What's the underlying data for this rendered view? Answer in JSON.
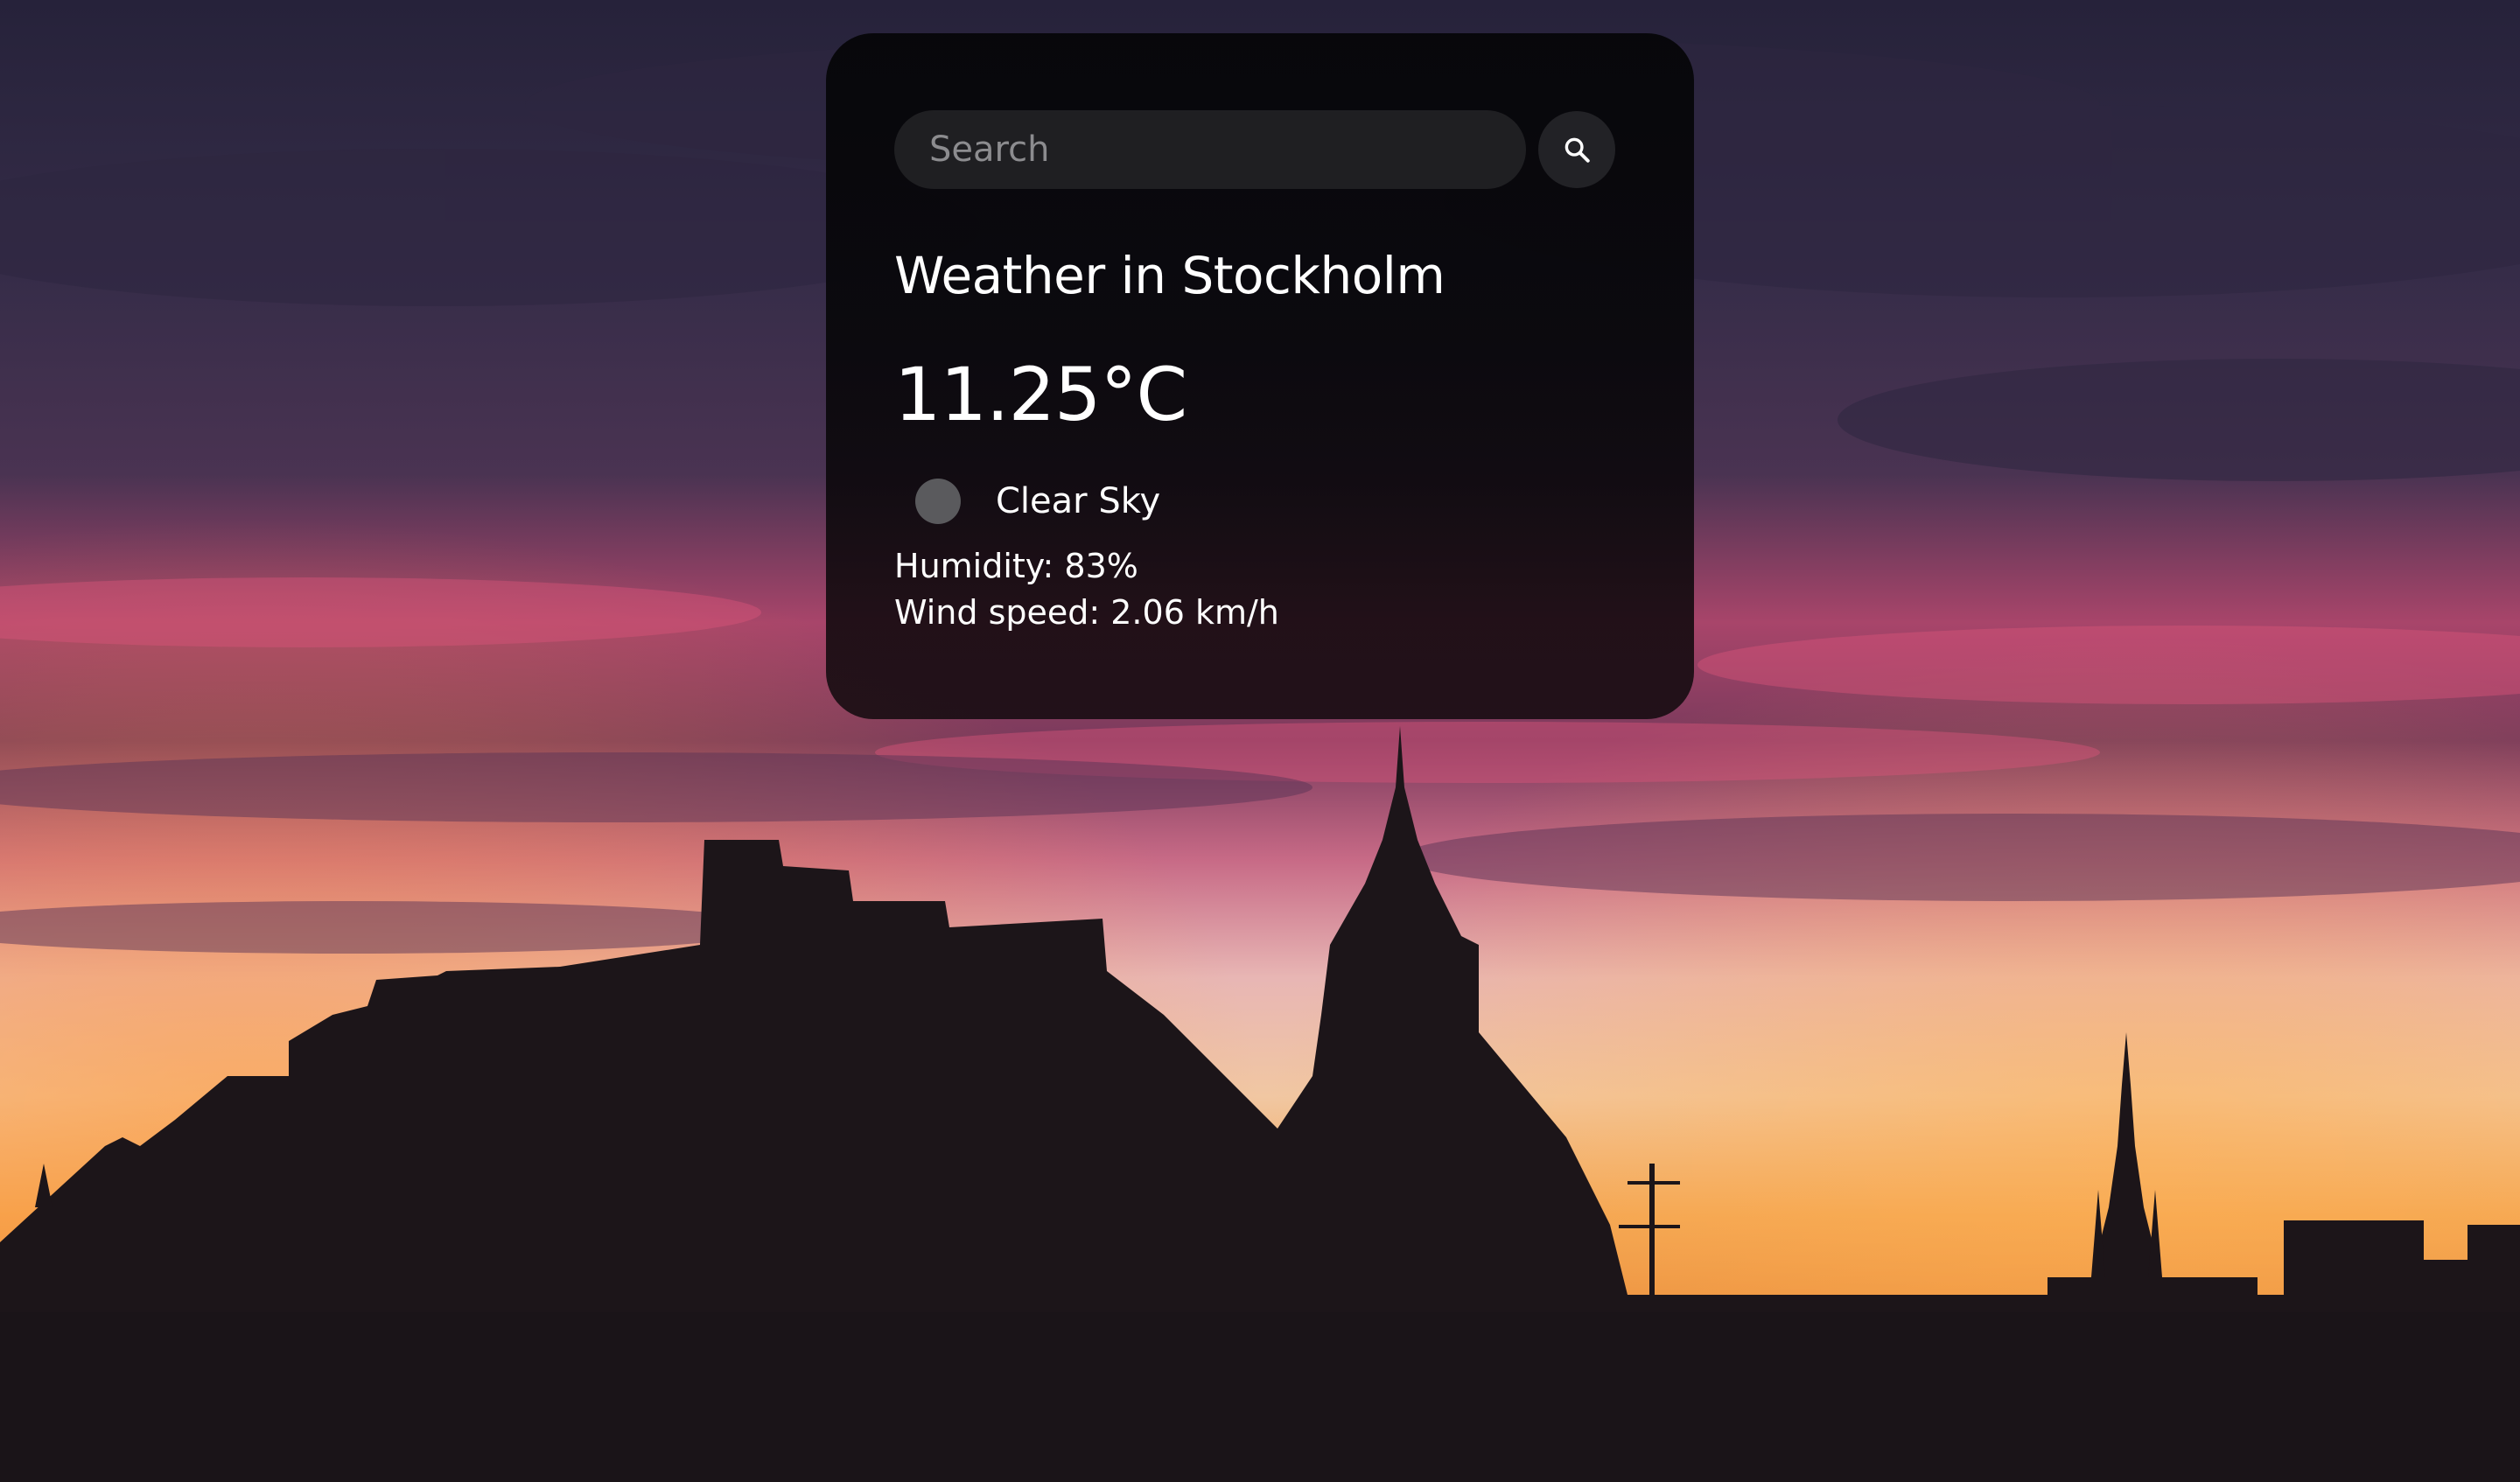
{
  "search": {
    "placeholder": "Search",
    "value": "",
    "button_icon": "search-icon"
  },
  "weather": {
    "city_title": "Weather in Stockholm",
    "temperature": "11.25°C",
    "condition_icon": "weather-condition-icon",
    "description": "Clear Sky",
    "humidity": "Humidity: 83%",
    "wind": "Wind speed: 2.06 km/h"
  },
  "colors": {
    "card_background": "#060609",
    "input_background": "#1f1f22",
    "text": "#ffffff",
    "placeholder": "#8c8c8f",
    "sky_top": "#2a2538",
    "sky_pink": "#c84a6a",
    "sky_horizon": "#f2a24a",
    "silhouette": "#1c1519"
  }
}
